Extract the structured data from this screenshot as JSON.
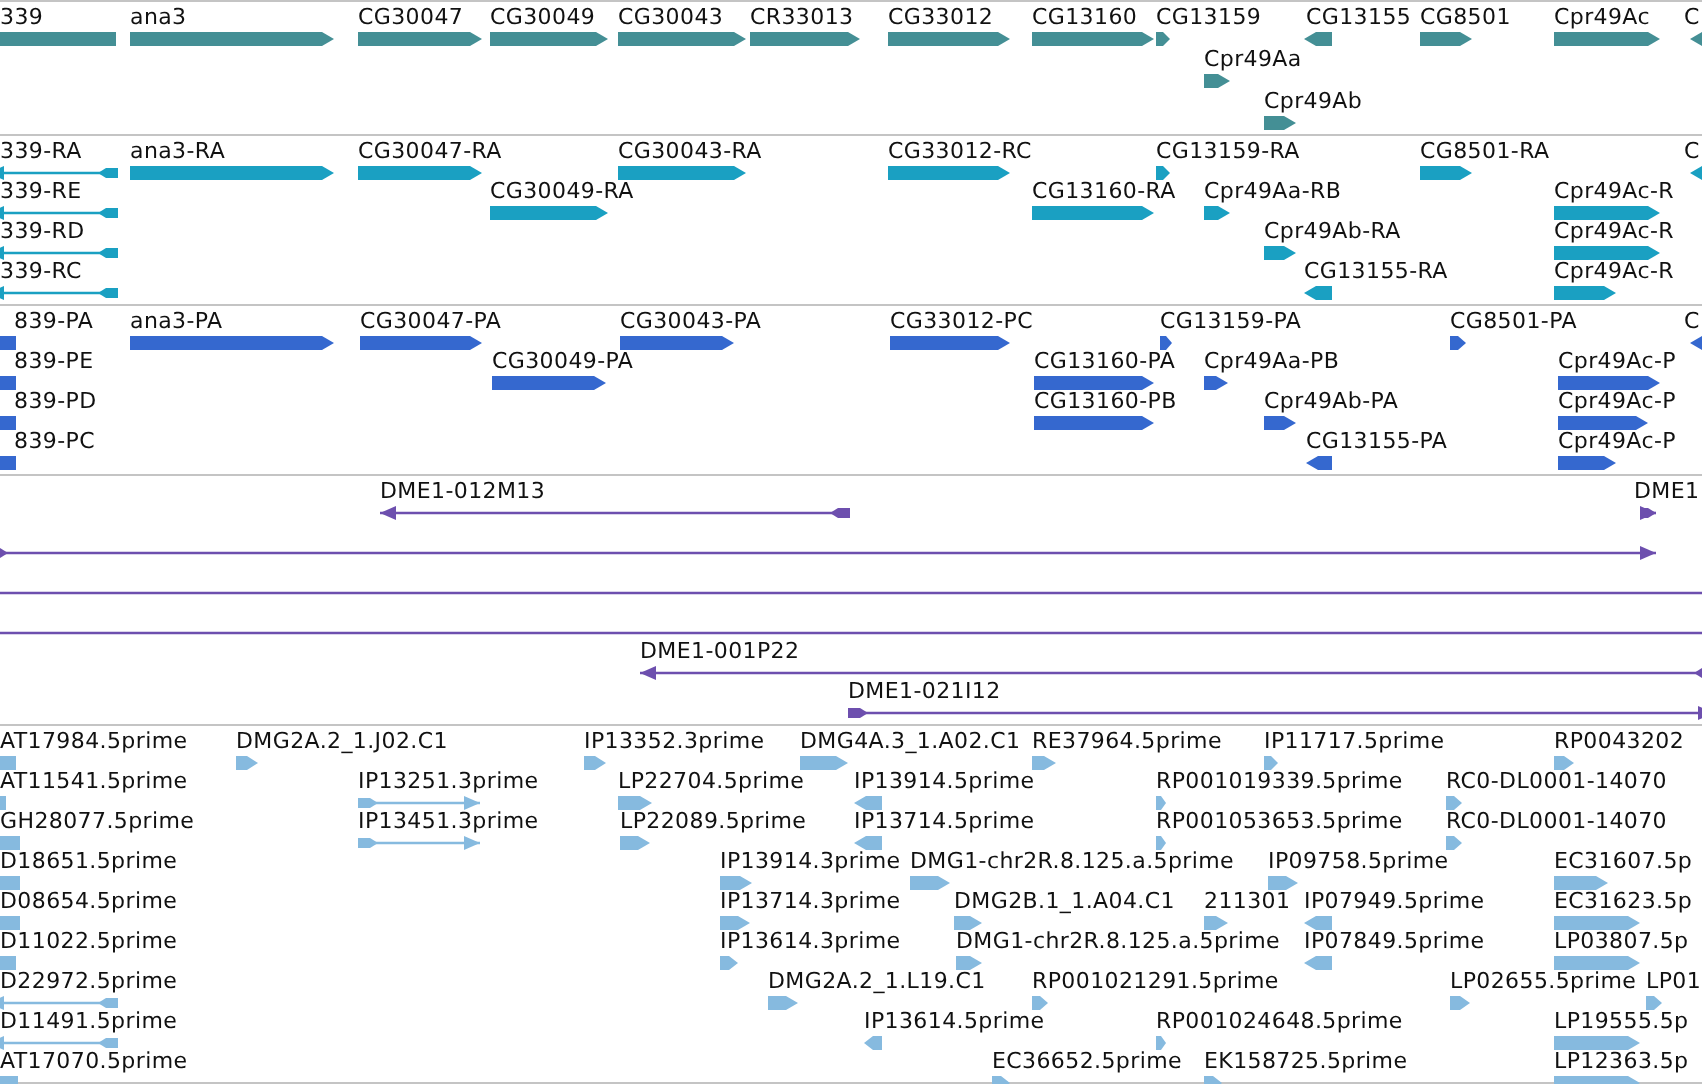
{
  "tracks": [
    {
      "kind": "gene",
      "rows": [
        {
          "features": [
            {
              "label": "339",
              "reverse": true
            },
            {
              "label": "ana3",
              "reverse": false
            },
            {
              "label": "CG30047",
              "reverse": false
            },
            {
              "label": "CG30049",
              "reverse": false
            },
            {
              "label": "CG30043",
              "reverse": false
            },
            {
              "label": "CR33013",
              "reverse": false
            },
            {
              "label": "CG33012",
              "reverse": false
            },
            {
              "label": "CG13160",
              "reverse": false
            },
            {
              "label": "CG13159",
              "reverse": false
            },
            {
              "label": "CG13155",
              "reverse": true
            },
            {
              "label": "CG8501",
              "reverse": false
            },
            {
              "label": "Cpr49Ac",
              "reverse": false
            },
            {
              "label": "C",
              "reverse": true
            }
          ]
        },
        {
          "features": [
            {
              "label": "Cpr49Aa",
              "reverse": false
            }
          ]
        },
        {
          "features": [
            {
              "label": "Cpr49Ab",
              "reverse": false
            }
          ]
        }
      ]
    },
    {
      "kind": "transcript",
      "rows": [
        {
          "features": [
            {
              "label": "339-RA",
              "reverse": true
            },
            {
              "label": "ana3-RA",
              "reverse": false
            },
            {
              "label": "CG30047-RA",
              "reverse": false
            },
            {
              "label": "CG30043-RA",
              "reverse": false
            },
            {
              "label": "CG33012-RC",
              "reverse": false
            },
            {
              "label": "CG13159-RA",
              "reverse": false
            },
            {
              "label": "CG8501-RA",
              "reverse": false
            },
            {
              "label": "C",
              "reverse": true
            }
          ]
        },
        {
          "features": [
            {
              "label": "339-RE",
              "reverse": true
            },
            {
              "label": "CG30049-RA",
              "reverse": false
            },
            {
              "label": "CG13160-RA",
              "reverse": false
            },
            {
              "label": "Cpr49Aa-RB",
              "reverse": false
            },
            {
              "label": "Cpr49Ac-R",
              "reverse": false
            }
          ]
        },
        {
          "features": [
            {
              "label": "339-RD",
              "reverse": true
            },
            {
              "label": "Cpr49Ab-RA",
              "reverse": false
            },
            {
              "label": "Cpr49Ac-R",
              "reverse": false
            }
          ]
        },
        {
          "features": [
            {
              "label": "339-RC",
              "reverse": true
            },
            {
              "label": "CG13155-RA",
              "reverse": true
            },
            {
              "label": "Cpr49Ac-R",
              "reverse": false
            }
          ]
        }
      ]
    },
    {
      "kind": "protein",
      "rows": [
        {
          "features": [
            {
              "label": "839-PA",
              "reverse": true
            },
            {
              "label": "ana3-PA",
              "reverse": false
            },
            {
              "label": "CG30047-PA",
              "reverse": false
            },
            {
              "label": "CG30043-PA",
              "reverse": false
            },
            {
              "label": "CG33012-PC",
              "reverse": false
            },
            {
              "label": "CG13159-PA",
              "reverse": false
            },
            {
              "label": "CG8501-PA",
              "reverse": false
            },
            {
              "label": "C",
              "reverse": true
            }
          ]
        },
        {
          "features": [
            {
              "label": "839-PE",
              "reverse": true
            },
            {
              "label": "CG30049-PA",
              "reverse": false
            },
            {
              "label": "CG13160-PA",
              "reverse": false
            },
            {
              "label": "Cpr49Aa-PB",
              "reverse": false
            },
            {
              "label": "Cpr49Ac-P",
              "reverse": false
            }
          ]
        },
        {
          "features": [
            {
              "label": "839-PD",
              "reverse": true
            },
            {
              "label": "CG13160-PB",
              "reverse": false
            },
            {
              "label": "Cpr49Ab-PA",
              "reverse": false
            },
            {
              "label": "Cpr49Ac-P",
              "reverse": false
            }
          ]
        },
        {
          "features": [
            {
              "label": "839-PC",
              "reverse": true
            },
            {
              "label": "CG13155-PA",
              "reverse": true
            },
            {
              "label": "Cpr49Ac-P",
              "reverse": false
            }
          ]
        }
      ]
    },
    {
      "kind": "clone",
      "rows": [
        {
          "features": [
            {
              "kind": "arrow",
              "label": "DME1-012M13",
              "reverse": true
            },
            {
              "kind": "arrow",
              "label": "DME1",
              "reverse": false
            }
          ]
        },
        {
          "features": [
            {
              "kind": "arrow",
              "reverse": false
            }
          ]
        },
        {
          "features": [
            {
              "kind": "span"
            }
          ]
        },
        {
          "features": [
            {
              "kind": "span"
            }
          ]
        },
        {
          "features": [
            {
              "kind": "arrow",
              "label": "DME1-001P22",
              "reverse": true
            }
          ]
        },
        {
          "features": [
            {
              "kind": "arrow",
              "label": "DME1-021I12",
              "reverse": false
            }
          ]
        }
      ]
    },
    {
      "kind": "est",
      "rows": [
        {
          "features": [
            {
              "label": "AT17984.5prime",
              "reverse": true
            },
            {
              "label": "DMG2A.2_1.J02.C1",
              "reverse": false
            },
            {
              "label": "IP13352.3prime",
              "reverse": false
            },
            {
              "label": "DMG4A.3_1.A02.C1",
              "reverse": false
            },
            {
              "label": "RE37964.5prime",
              "reverse": false
            },
            {
              "label": "IP11717.5prime",
              "reverse": false
            },
            {
              "label": "RP0043202",
              "reverse": false
            }
          ]
        },
        {
          "features": [
            {
              "label": "AT11541.5prime",
              "reverse": true
            },
            {
              "label": "IP13251.3prime",
              "reverse": false
            },
            {
              "label": "LP22704.5prime",
              "reverse": false
            },
            {
              "label": "IP13914.5prime",
              "reverse": true
            },
            {
              "label": "RP001019339.5prime",
              "reverse": false
            },
            {
              "label": "RC0-DL0001-14070",
              "reverse": false
            }
          ]
        },
        {
          "features": [
            {
              "label": "GH28077.5prime",
              "reverse": true
            },
            {
              "label": "IP13451.3prime",
              "reverse": false
            },
            {
              "label": "LP22089.5prime",
              "reverse": false
            },
            {
              "label": "IP13714.5prime",
              "reverse": true
            },
            {
              "label": "RP001053653.5prime",
              "reverse": false
            },
            {
              "label": "RC0-DL0001-14070",
              "reverse": false
            }
          ]
        },
        {
          "features": [
            {
              "label": "D18651.5prime",
              "reverse": true
            },
            {
              "label": "IP13914.3prime",
              "reverse": false
            },
            {
              "label": "DMG1-chr2R.8.125.a.5prime",
              "reverse": false
            },
            {
              "label": "IP09758.5prime",
              "reverse": false
            },
            {
              "label": "EC31607.5p",
              "reverse": false
            }
          ]
        },
        {
          "features": [
            {
              "label": "D08654.5prime",
              "reverse": true
            },
            {
              "label": "IP13714.3prime",
              "reverse": false
            },
            {
              "label": "DMG2B.1_1.A04.C1",
              "reverse": false
            },
            {
              "label": "211301",
              "reverse": false
            },
            {
              "label": "IP07949.5prime",
              "reverse": true
            },
            {
              "label": "EC31623.5p",
              "reverse": false
            }
          ]
        },
        {
          "features": [
            {
              "label": "D11022.5prime",
              "reverse": true
            },
            {
              "label": "IP13614.3prime",
              "reverse": false
            },
            {
              "label": "DMG1-chr2R.8.125.a.5prime",
              "reverse": false
            },
            {
              "label": "IP07849.5prime",
              "reverse": true
            },
            {
              "label": "LP03807.5p",
              "reverse": false
            }
          ]
        },
        {
          "features": [
            {
              "label": "D22972.5prime",
              "reverse": true
            },
            {
              "label": "DMG2A.2_1.L19.C1",
              "reverse": false
            },
            {
              "label": "RP001021291.5prime",
              "reverse": false
            },
            {
              "label": "LP02655.5prime",
              "reverse": false
            },
            {
              "label": "LP01",
              "reverse": false
            }
          ]
        },
        {
          "features": [
            {
              "label": "D11491.5prime",
              "reverse": true
            },
            {
              "label": "IP13614.5prime",
              "reverse": true
            },
            {
              "label": "RP001024648.5prime",
              "reverse": false
            },
            {
              "label": "LP19555.5p",
              "reverse": false
            }
          ]
        },
        {
          "features": [
            {
              "label": "AT17070.5prime",
              "reverse": true
            },
            {
              "label": "EC36652.5prime",
              "reverse": false
            },
            {
              "label": "EK158725.5prime",
              "reverse": false
            },
            {
              "label": "LP12363.5p",
              "reverse": false
            }
          ]
        }
      ]
    }
  ]
}
